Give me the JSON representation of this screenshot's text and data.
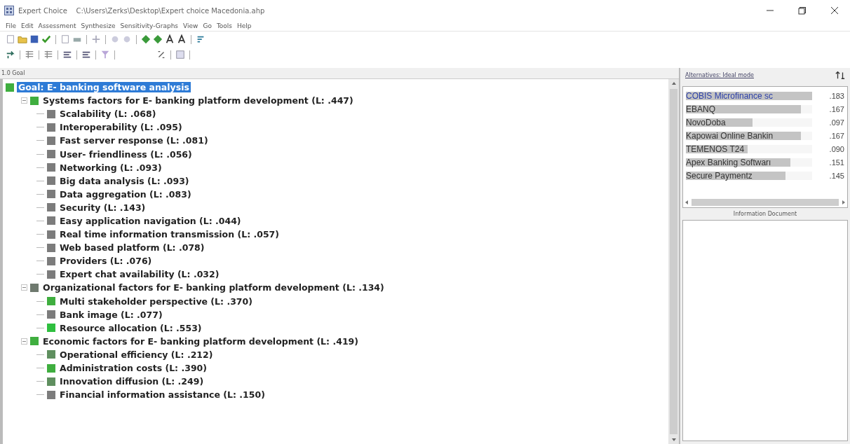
{
  "window": {
    "title": "Expert Choice    C:\\Users\\Zerks\\Desktop\\Expert choice Macedonia.ahp"
  },
  "menu": [
    {
      "label": "File"
    },
    {
      "label": "Edit"
    },
    {
      "label": "Assessment"
    },
    {
      "label": "Synthesize"
    },
    {
      "label": "Sensitivity-Graphs"
    },
    {
      "label": "View"
    },
    {
      "label": "Go"
    },
    {
      "label": "Tools"
    },
    {
      "label": "Help"
    }
  ],
  "path_bar": "1.0 Goal",
  "tree": {
    "label": "Goal: E- banking software analysis",
    "color": "#3fae3f",
    "selected": true,
    "children": [
      {
        "label": "Systems factors for E- banking platform development (L: .447)",
        "color": "#3fae3f",
        "selected": false,
        "expanded": true,
        "children": [
          {
            "label": "Scalability (L: .068)",
            "color": "#7c7c7c",
            "selected": false
          },
          {
            "label": "Interoperability (L: .095)",
            "color": "#7c7c7c",
            "selected": false
          },
          {
            "label": "Fast server response (L: .081)",
            "color": "#7c7c7c",
            "selected": false
          },
          {
            "label": "User- friendliness (L: .056)",
            "color": "#7c7c7c",
            "selected": false
          },
          {
            "label": "Networking (L: .093)",
            "color": "#7c7c7c",
            "selected": false
          },
          {
            "label": "Big data analysis (L: .093)",
            "color": "#7c7c7c",
            "selected": false
          },
          {
            "label": "Data aggregation (L: .083)",
            "color": "#7c7c7c",
            "selected": false
          },
          {
            "label": "Security (L: .143)",
            "color": "#7c7c7c",
            "selected": false
          },
          {
            "label": "Easy application navigation (L: .044)",
            "color": "#7c7c7c",
            "selected": false
          },
          {
            "label": "Real time information transmission (L: .057)",
            "color": "#7c7c7c",
            "selected": false
          },
          {
            "label": "Web based platform (L: .078)",
            "color": "#7c7c7c",
            "selected": false
          },
          {
            "label": "Providers (L: .076)",
            "color": "#7c7c7c",
            "selected": false
          },
          {
            "label": "Expert chat availability (L: .032)",
            "color": "#7c7c7c",
            "selected": false
          }
        ]
      },
      {
        "label": "Organizational factors for E- banking platform development (L: .134)",
        "color": "#6f7a6f",
        "selected": false,
        "expanded": true,
        "children": [
          {
            "label": "Multi stakeholder perspective (L: .370)",
            "color": "#3fae3f",
            "selected": false
          },
          {
            "label": "Bank image (L: .077)",
            "color": "#7c7c7c",
            "selected": false
          },
          {
            "label": "Resource allocation (L: .553)",
            "color": "#2fbf3f",
            "selected": false
          }
        ]
      },
      {
        "label": "Economic factors for E- banking platform development (L: .419)",
        "color": "#3fae3f",
        "selected": false,
        "expanded": true,
        "children": [
          {
            "label": "Operational efficiency (L: .212)",
            "color": "#5f8f5f",
            "selected": false
          },
          {
            "label": "Administration costs (L: .390)",
            "color": "#3fae3f",
            "selected": false
          },
          {
            "label": "Innovation diffusion (L: .249)",
            "color": "#5f8f5f",
            "selected": false
          },
          {
            "label": "Financial information assistance (L: .150)",
            "color": "#7c7c7c",
            "selected": false
          }
        ]
      }
    ]
  },
  "alternatives_panel": {
    "title": "Alternatives: Ideal mode",
    "items": [
      {
        "name": "COBIS Microfinance sc",
        "value": ".183",
        "level": 1.0,
        "selected": true
      },
      {
        "name": "EBANQ",
        "value": ".167",
        "level": 0.91,
        "selected": false
      },
      {
        "name": "NovoDoba",
        "value": ".097",
        "level": 0.53,
        "selected": false
      },
      {
        "name": "Kapowai Online Bankin",
        "value": ".167",
        "level": 0.91,
        "selected": false
      },
      {
        "name": "TEMENOS T24",
        "value": ".090",
        "level": 0.49,
        "selected": false
      },
      {
        "name": "Apex Banking Softwarı",
        "value": ".151",
        "level": 0.83,
        "selected": false
      },
      {
        "name": "Secure Paymentz",
        "value": ".145",
        "level": 0.79,
        "selected": false
      }
    ]
  },
  "info_panel": {
    "title": "Information Document"
  }
}
